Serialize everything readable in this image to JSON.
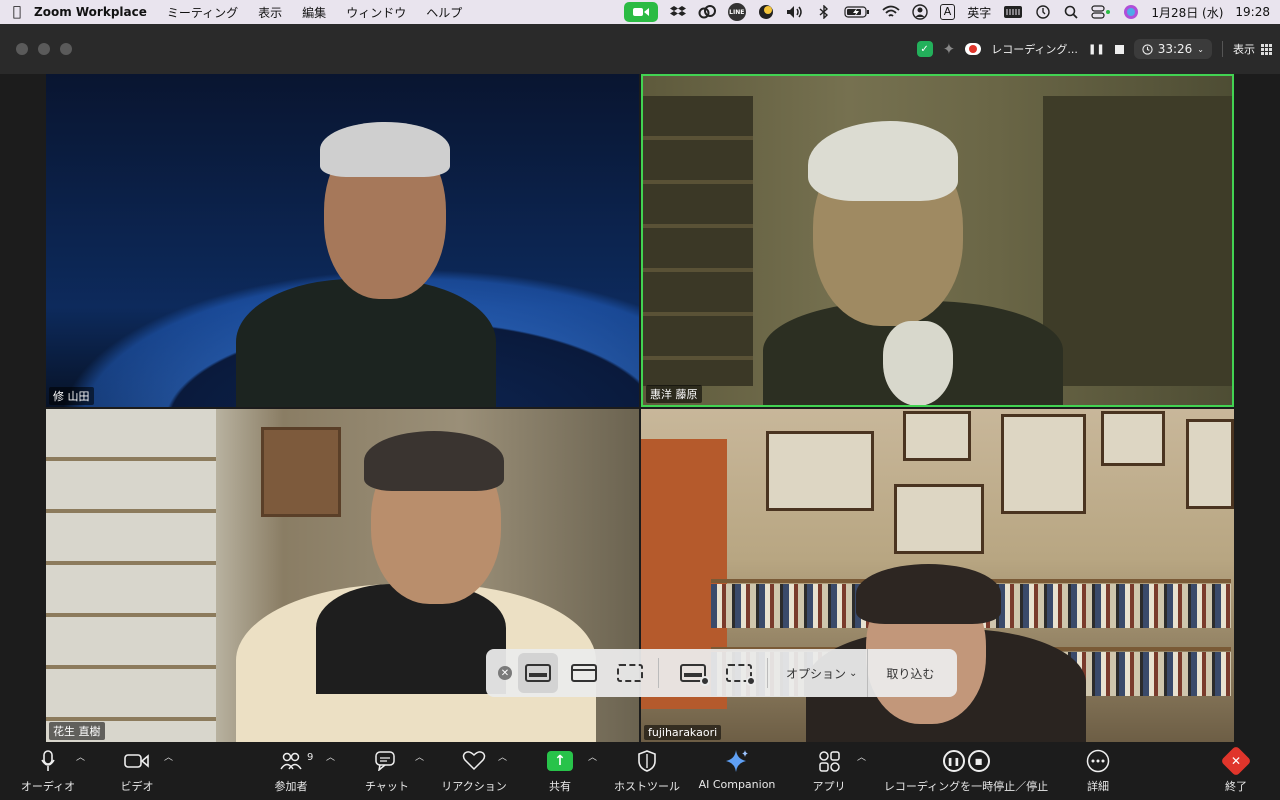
{
  "menubar": {
    "apple_icon": "apple-logo",
    "app_name": "Zoom Workplace",
    "menus": [
      "ミーティング",
      "表示",
      "編集",
      "ウィンドウ",
      "ヘルプ"
    ],
    "line_label": "LINE",
    "input_mode_letter": "A",
    "input_mode": "英字",
    "date": "1月28日 (水)",
    "time": "19:28"
  },
  "titlebar": {
    "recording_label": "レコーディング...",
    "timer": "33:26",
    "view_label": "表示"
  },
  "participants": [
    {
      "name": "修 山田"
    },
    {
      "name": "惠洋 藤原"
    },
    {
      "name": "花生 直樹"
    },
    {
      "name": "fujiharakaori"
    }
  ],
  "share_toolbar": {
    "options_label": "オプション",
    "import_label": "取り込む"
  },
  "controls": {
    "audio": "オーディオ",
    "video": "ビデオ",
    "participants": "参加者",
    "participants_count": "9",
    "chat": "チャット",
    "reactions": "リアクション",
    "share": "共有",
    "host_tools": "ホストツール",
    "ai_companion": "AI Companion",
    "apps": "アプリ",
    "recording": "レコーディングを一時停止／停止",
    "more": "詳細",
    "end": "終了"
  },
  "colors": {
    "active_speaker_border": "#42d352",
    "share_green": "#28c34a",
    "end_red": "#e0352b"
  }
}
